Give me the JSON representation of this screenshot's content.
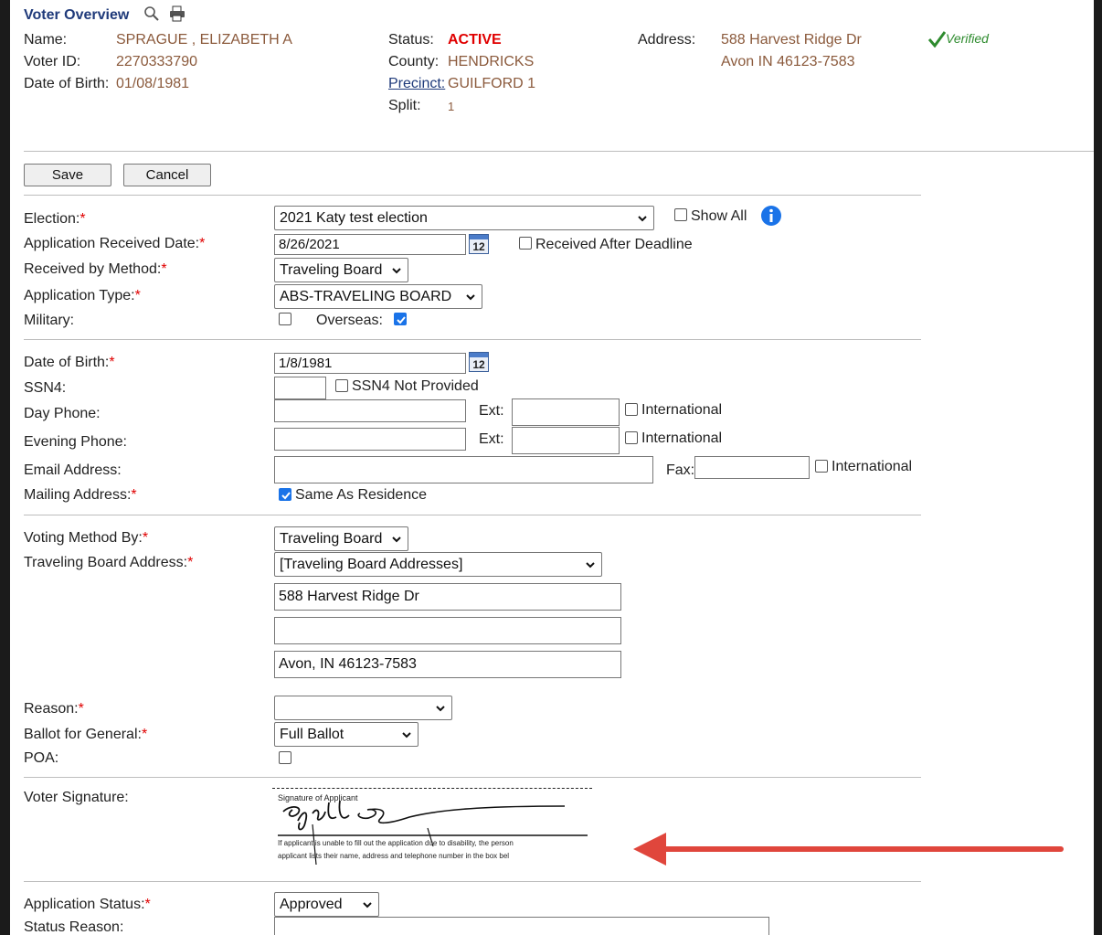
{
  "header": {
    "title": "Voter Overview",
    "name_label": "Name:",
    "name_value": "SPRAGUE , ELIZABETH A",
    "voter_id_label": "Voter ID:",
    "voter_id_value": "2270333790",
    "dob_label": "Date of Birth:",
    "dob_value": "01/08/1981",
    "status_label": "Status:",
    "status_value": "ACTIVE",
    "county_label": "County:",
    "county_value": "HENDRICKS",
    "precinct_label": "Precinct:",
    "precinct_value": "GUILFORD 1",
    "split_label": "Split:",
    "split_value": "1",
    "address_label": "Address:",
    "address_line1": "588 Harvest Ridge Dr",
    "address_line2": "Avon IN 46123-7583",
    "verified": "Verified"
  },
  "toolbar": {
    "save_label": "Save",
    "cancel_label": "Cancel"
  },
  "form": {
    "election_label": "Election:",
    "election_value": "2021 Katy test election",
    "show_all_label": "Show All",
    "app_received_label": "Application Received Date:",
    "app_received_value": "8/26/2021",
    "received_after_label": "Received After Deadline",
    "calendar_day": "12",
    "received_by_label": "Received by Method:",
    "received_by_value": "Traveling Board",
    "app_type_label": "Application Type:",
    "app_type_value": "ABS-TRAVELING BOARD",
    "military_label": "Military:",
    "overseas_label": "Overseas:",
    "dob_label": "Date of Birth:",
    "dob_value": "1/8/1981",
    "ssn4_label": "SSN4:",
    "ssn4_not_provided_label": "SSN4 Not Provided",
    "day_phone_label": "Day Phone:",
    "evening_phone_label": "Evening Phone:",
    "ext_label": "Ext:",
    "international_label": "International",
    "email_label": "Email Address:",
    "fax_label": "Fax:",
    "mailing_label": "Mailing Address:",
    "same_as_residence_label": "Same As Residence",
    "voting_method_label": "Voting Method By:",
    "voting_method_value": "Traveling Board",
    "tb_address_label": "Traveling Board Address:",
    "tb_address_select": "[Traveling Board Addresses]",
    "tb_address_line1": "588 Harvest Ridge Dr",
    "tb_address_line2": "",
    "tb_address_line3": "Avon, IN  46123-7583",
    "reason_label": "Reason:",
    "reason_value": "",
    "ballot_general_label": "Ballot for General:",
    "ballot_general_value": "Full Ballot",
    "poa_label": "POA:",
    "signature_label": "Voter Signature:",
    "signature_header": "Signature of Applicant",
    "signature_note1": "If applicant is unable to fill out the application due to disability, the person",
    "signature_note2": "applicant lists their name, address and telephone number in the box bel",
    "app_status_label": "Application Status:",
    "app_status_value": "Approved",
    "status_reason_label": "Status Reason:"
  },
  "colors": {
    "required": "#e00000",
    "accent": "#1a73e8",
    "arrow": "#e0463c",
    "brown": "#8b5a3c"
  }
}
